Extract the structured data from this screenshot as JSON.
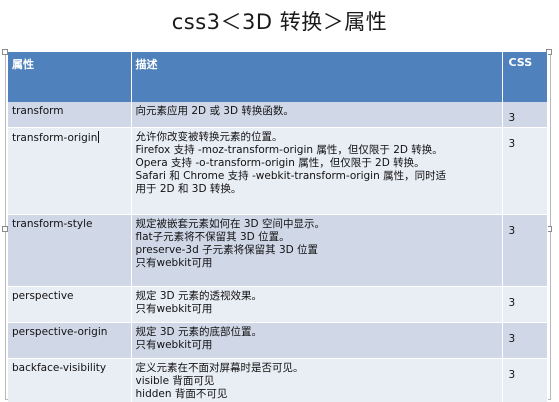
{
  "title": "css3＜3D 转换＞属性",
  "table": {
    "headers": [
      "属性",
      "描述",
      "CSS"
    ],
    "rows": [
      {
        "property": "transform",
        "lines": [
          "向元素应用 2D 或 3D 转换函数。"
        ],
        "css": "3"
      },
      {
        "property": "transform-origin",
        "lines": [
          "允许你改变被转换元素的位置。",
          "Firefox 支持 -moz-transform-origin 属性，但仅限于 2D 转换。",
          "Opera 支持 -o-transform-origin 属性，但仅限于 2D 转换。",
          "Safari 和 Chrome 支持 -webkit-transform-origin 属性，同时适",
          "用于 2D 和 3D 转换。"
        ],
        "css": "3"
      },
      {
        "property": "transform-style",
        "lines": [
          "规定被嵌套元素如何在 3D 空间中显示。",
          "flat子元素将不保留其 3D 位置。",
          "preserve-3d 子元素将保留其 3D 位置",
          "只有webkit可用"
        ],
        "css": "3"
      },
      {
        "property": "perspective",
        "lines": [
          "规定 3D 元素的透视效果。",
          "只有webkit可用"
        ],
        "css": "3"
      },
      {
        "property": "perspective-origin",
        "lines": [
          "规定 3D 元素的底部位置。",
          "只有webkit可用"
        ],
        "css": "3"
      },
      {
        "property": "backface-visibility",
        "lines": [
          "定义元素在不面对屏幕时是否可见。",
          "visible  背面可见",
          "hidden 背面不可见"
        ],
        "css": "3"
      }
    ]
  },
  "colors": {
    "header": "#4f81bd",
    "band": "#d0d8e8",
    "plain": "#e9edf4"
  }
}
